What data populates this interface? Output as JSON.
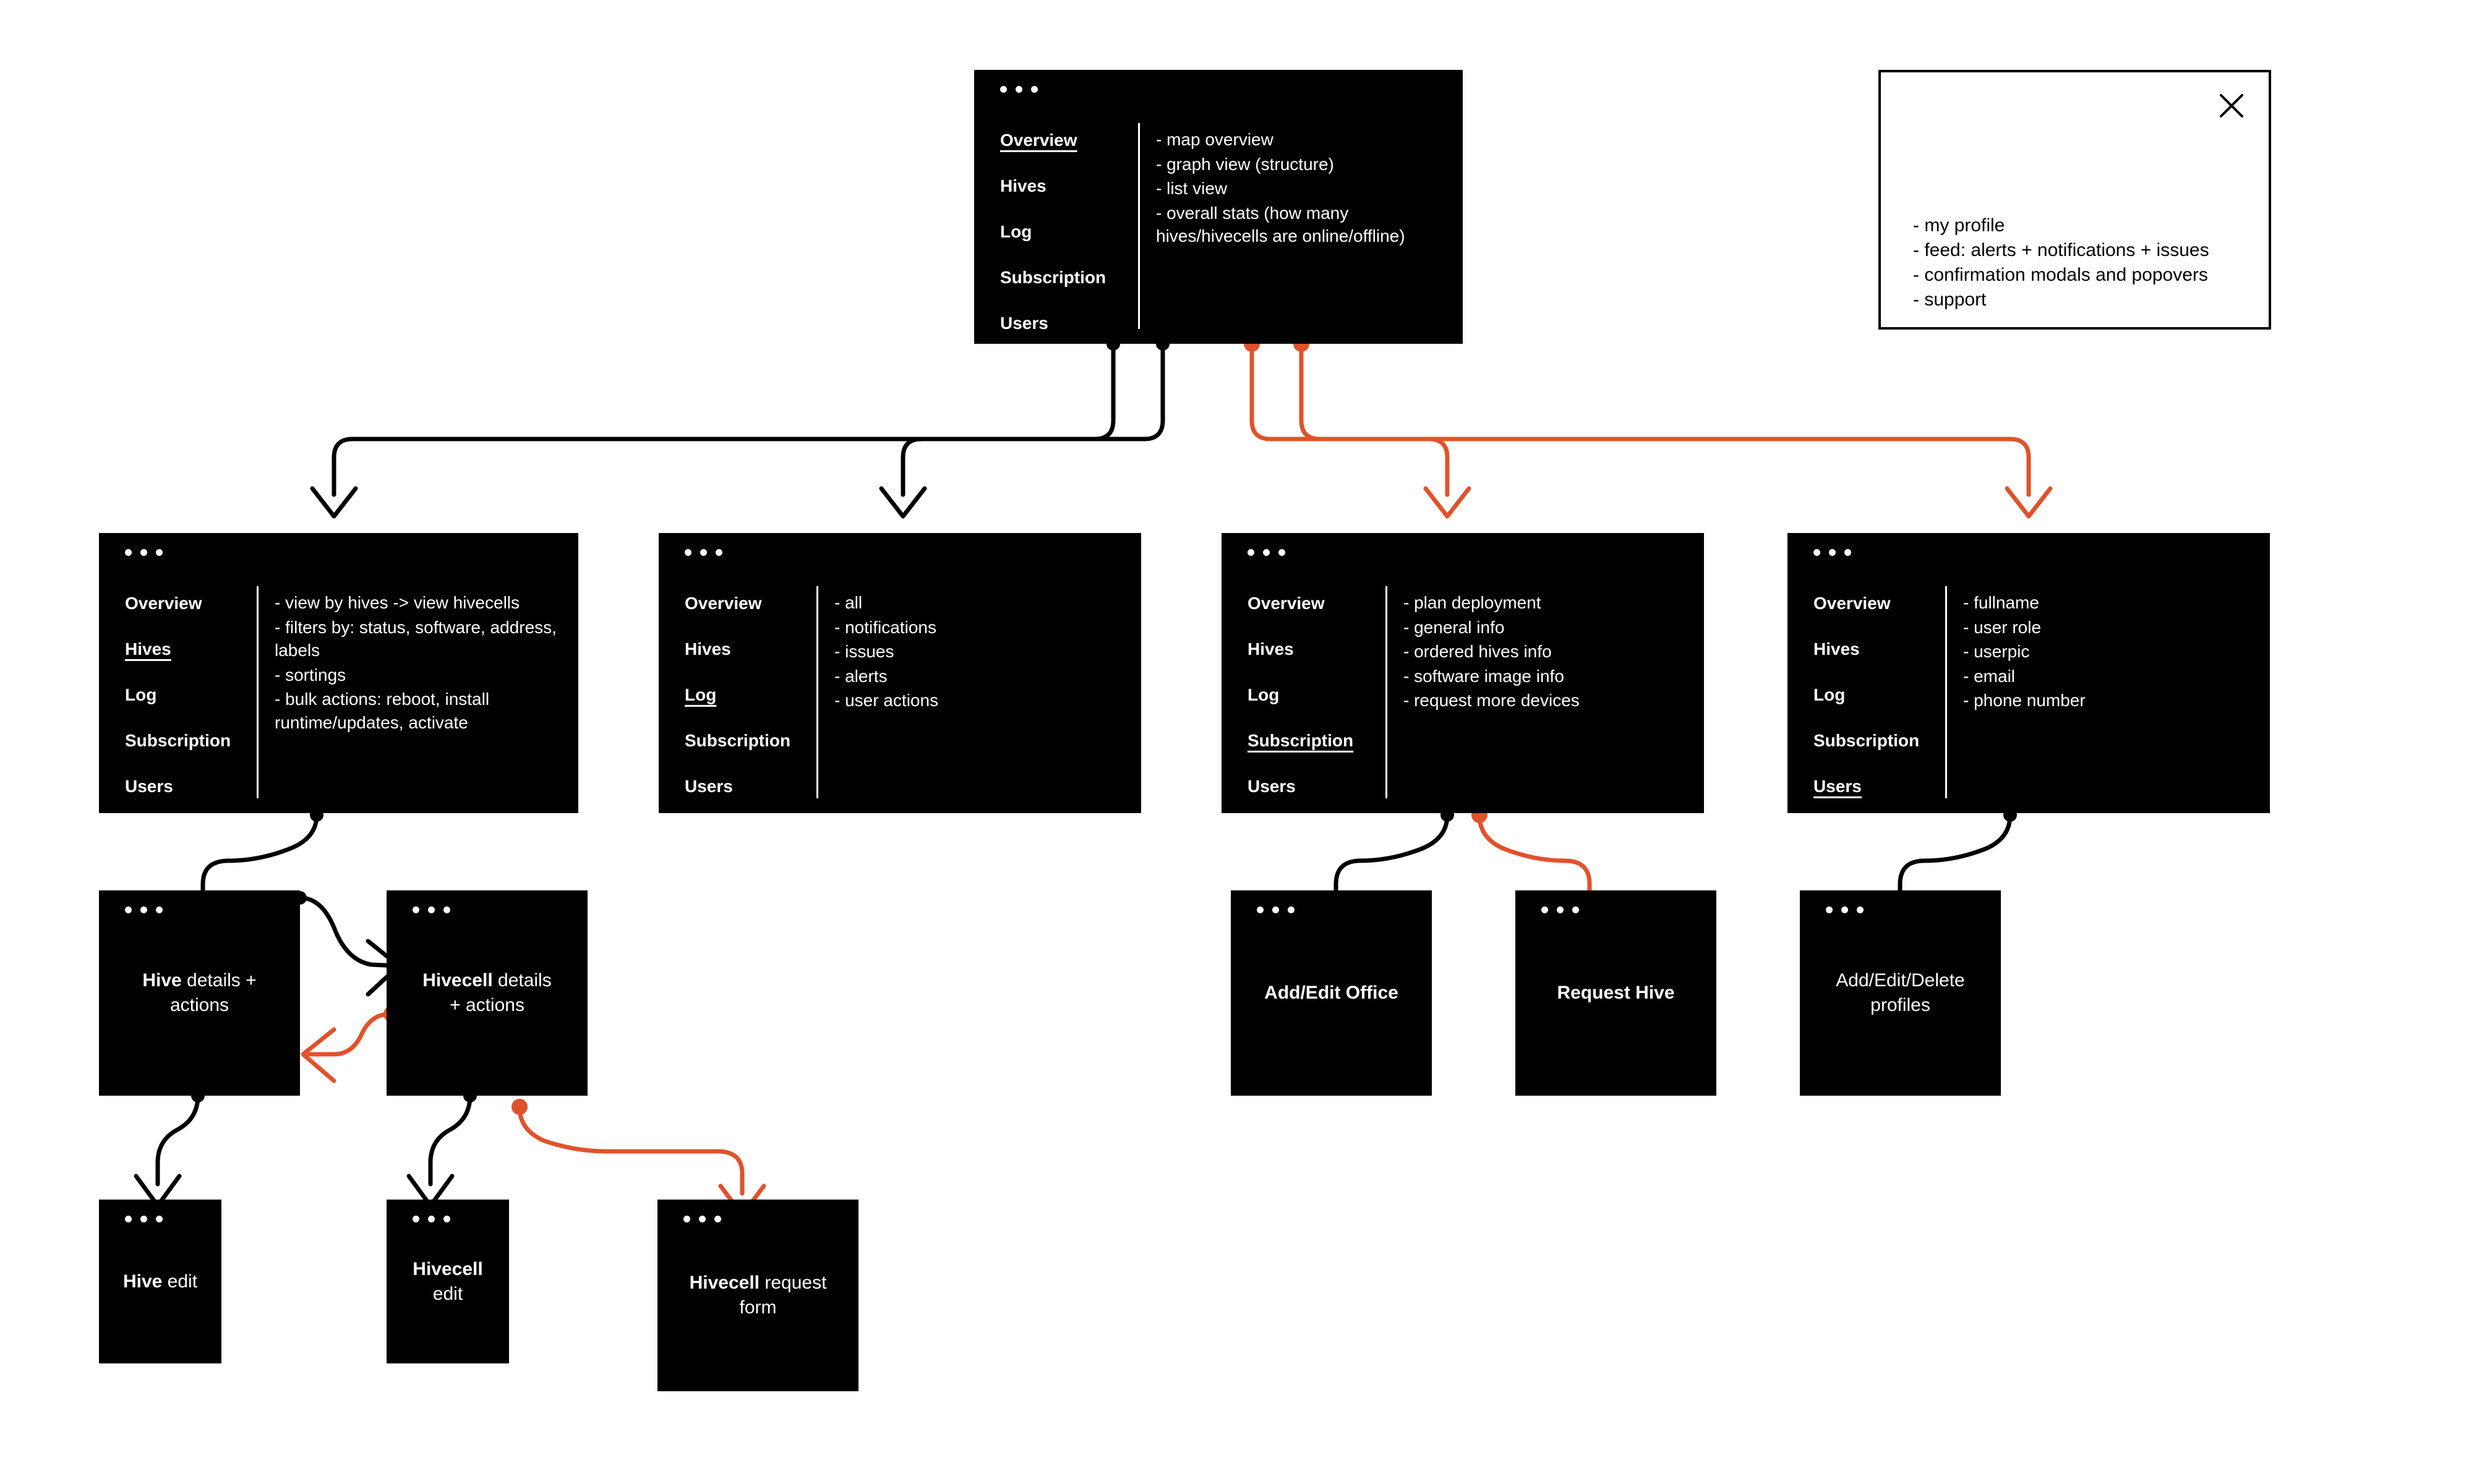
{
  "meta": {
    "accent_color": "#E0522C",
    "card_bg": "#000000",
    "card_fg": "#FFFFFF",
    "page_bg": "#FFFFFF"
  },
  "nav_labels": {
    "overview": "Overview",
    "hives": "Hives",
    "log": "Log",
    "subscription": "Subscription",
    "users": "Users"
  },
  "cards": {
    "overview": {
      "nav": [
        "Overview",
        "Hives",
        "Log",
        "Subscription",
        "Users"
      ],
      "active": "Overview",
      "details": [
        "- map overview",
        "- graph view (structure)",
        "- list view",
        "- overall stats (how many hives/hivecells are online/offline)"
      ]
    },
    "hives": {
      "nav": [
        "Overview",
        "Hives",
        "Log",
        "Subscription",
        "Users"
      ],
      "active": "Hives",
      "details": [
        "- view by hives -> view hivecells",
        "- filters by: status, software, address, labels",
        "- sortings",
        "- bulk actions: reboot, install runtime/updates, activate"
      ]
    },
    "log": {
      "nav": [
        "Overview",
        "Hives",
        "Log",
        "Subscription",
        "Users"
      ],
      "active": "Log",
      "details": [
        "- all",
        "- notifications",
        "- issues",
        "- alerts",
        "- user actions"
      ]
    },
    "subscription": {
      "nav": [
        "Overview",
        "Hives",
        "Log",
        "Subscription",
        "Users"
      ],
      "active": "Subscription",
      "details": [
        "- plan deployment",
        "- general info",
        "- ordered hives info",
        "- software image info",
        "- request more devices"
      ]
    },
    "users": {
      "nav": [
        "Overview",
        "Hives",
        "Log",
        "Subscription",
        "Users"
      ],
      "active": "Users",
      "details": [
        "- fullname",
        "- user role",
        "- userpic",
        "- email",
        "- phone number"
      ]
    },
    "hive_details": {
      "bold": "Hive",
      "rest": " details +",
      "second": "actions"
    },
    "hivecell_details": {
      "bold": "Hivecell",
      "rest": " details",
      "second": "+ actions"
    },
    "hive_edit": {
      "bold": "Hive",
      "rest": " edit",
      "second": ""
    },
    "hivecell_edit": {
      "bold": "Hivecell",
      "rest": "",
      "second": "edit"
    },
    "hivecell_request_form": {
      "bold": "Hivecell",
      "rest": " request",
      "second": "form"
    },
    "add_edit_office": {
      "bold": "Add/Edit Office",
      "rest": "",
      "second": ""
    },
    "request_hive": {
      "bold": "Request Hive",
      "rest": "",
      "second": ""
    },
    "add_edit_delete_profiles": {
      "bold": "Add/Edit/Delete",
      "rest": "",
      "second": "profiles"
    }
  },
  "global_note": {
    "close_icon": "close-icon",
    "lines": [
      "- my profile",
      "- feed: alerts + notifications + issues",
      "- confirmation modals and popovers",
      "- support"
    ]
  }
}
